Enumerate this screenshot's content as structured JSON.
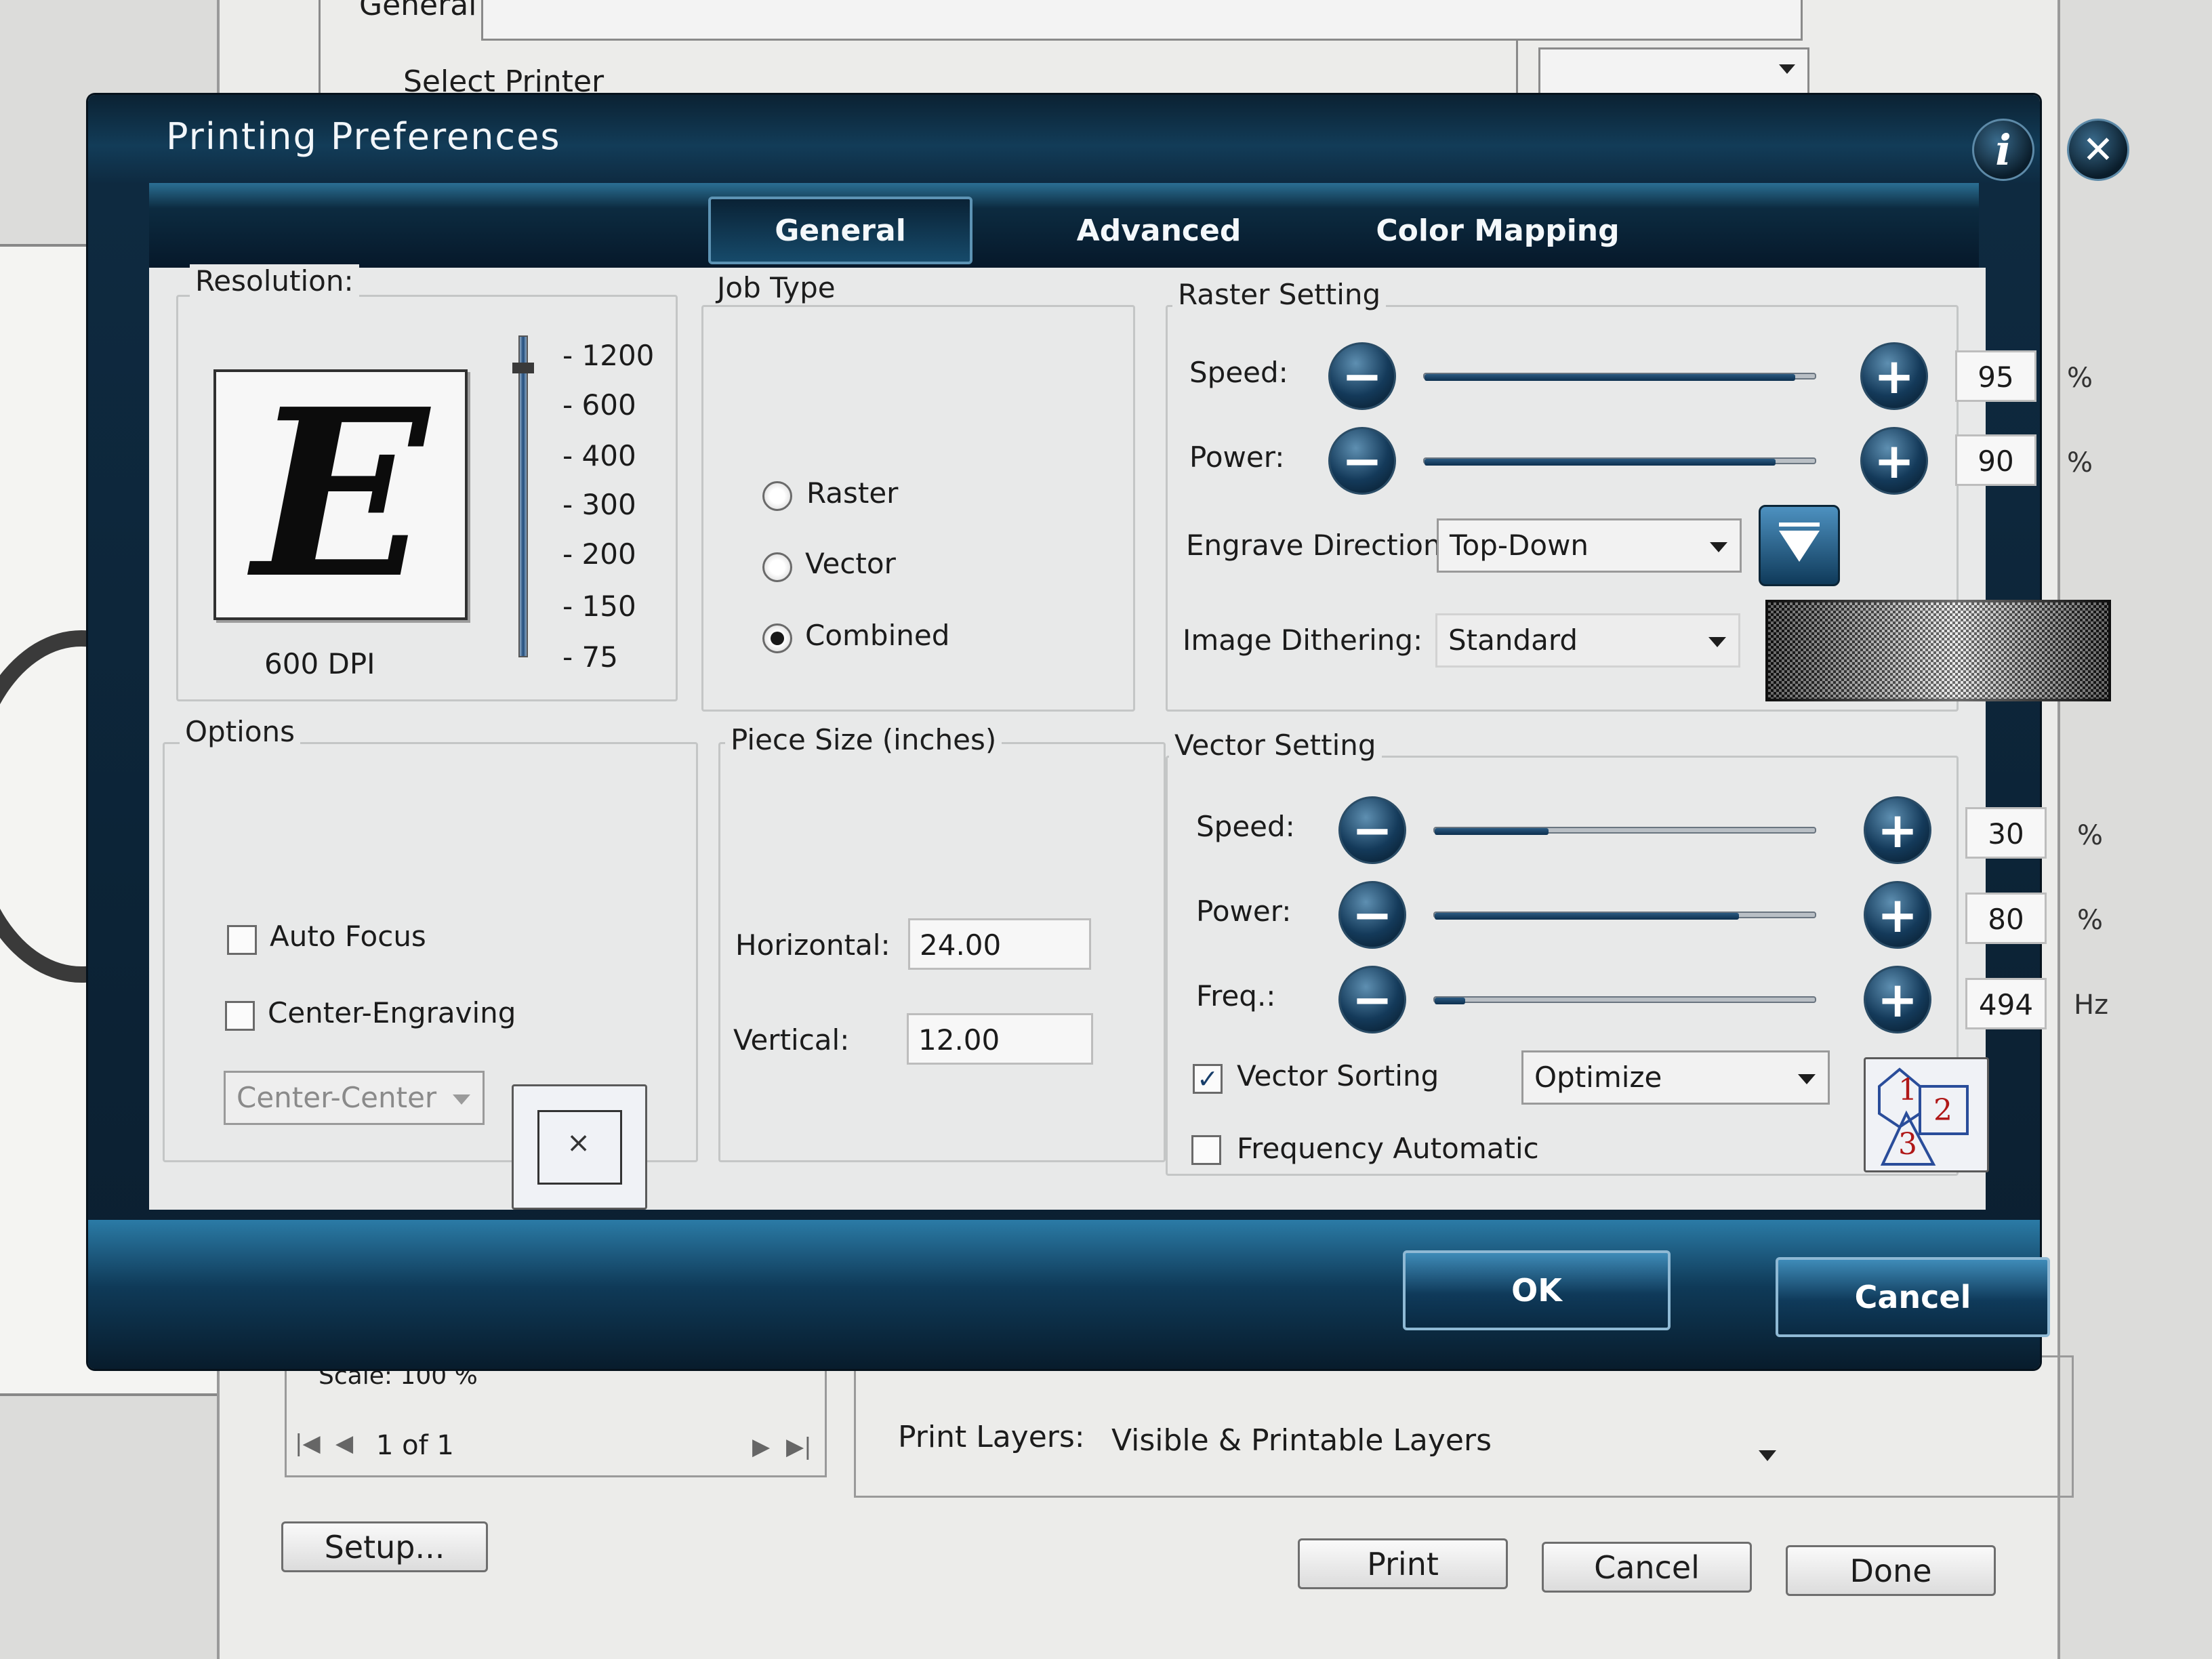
{
  "background_window": {
    "general_label": "General",
    "select_printer_label": "Select Printer",
    "scale_text": "Scale: 100 %",
    "page_indicator": "1 of 1",
    "print_layers_label": "Print Layers:",
    "print_layers_value": "Visible & Printable Layers",
    "setup_button": "Setup...",
    "print_button": "Print",
    "cancel_button": "Cancel",
    "done_button": "Done"
  },
  "dialog": {
    "title": "Printing Preferences",
    "info_icon": "info-icon",
    "close_icon": "close-icon",
    "tabs": [
      "General",
      "Advanced",
      "Color Mapping"
    ],
    "active_tab": "General",
    "ok_button": "OK",
    "cancel_button": "Cancel"
  },
  "resolution": {
    "label": "Resolution:",
    "preview_letter": "E",
    "current": "600 DPI",
    "ticks": [
      "1200",
      "600",
      "400",
      "300",
      "200",
      "150",
      "75"
    ]
  },
  "job_type": {
    "label": "Job Type",
    "options": [
      "Raster",
      "Vector",
      "Combined"
    ],
    "selected": "Combined"
  },
  "options": {
    "label": "Options",
    "auto_focus": "Auto Focus",
    "auto_focus_checked": false,
    "center_engraving": "Center-Engraving",
    "center_engraving_checked": false,
    "center_position": "Center-Center",
    "center_icon_mark": "×"
  },
  "piece_size": {
    "label": "Piece Size (inches)",
    "horizontal_label": "Horizontal:",
    "horizontal_value": "24.00",
    "vertical_label": "Vertical:",
    "vertical_value": "12.00"
  },
  "raster_setting": {
    "label": "Raster Setting",
    "speed_label": "Speed:",
    "speed_value": "95",
    "speed_unit": "%",
    "power_label": "Power:",
    "power_value": "90",
    "power_unit": "%",
    "engrave_direction_label": "Engrave Direction:",
    "engrave_direction_value": "Top-Down",
    "image_dithering_label": "Image Dithering:",
    "image_dithering_value": "Standard"
  },
  "vector_setting": {
    "label": "Vector Setting",
    "speed_label": "Speed:",
    "speed_value": "30",
    "speed_unit": "%",
    "power_label": "Power:",
    "power_value": "80",
    "power_unit": "%",
    "freq_label": "Freq.:",
    "freq_value": "494",
    "freq_unit": "Hz",
    "vector_sorting_label": "Vector Sorting",
    "vector_sorting_checked": true,
    "vector_sorting_mode": "Optimize",
    "frequency_automatic_label": "Frequency Automatic",
    "frequency_automatic_checked": false,
    "sort_icon_numbers": [
      "1",
      "2",
      "3"
    ]
  },
  "slider_fill": {
    "raster_speed": 0.95,
    "raster_power": 0.9,
    "vector_speed": 0.3,
    "vector_power": 0.8,
    "vector_freq": 0.08
  },
  "colors": {
    "dialog_dark": "#0b1f30",
    "accent_blue": "#2b7ba6",
    "panel_bg": "#e8e9e9"
  }
}
